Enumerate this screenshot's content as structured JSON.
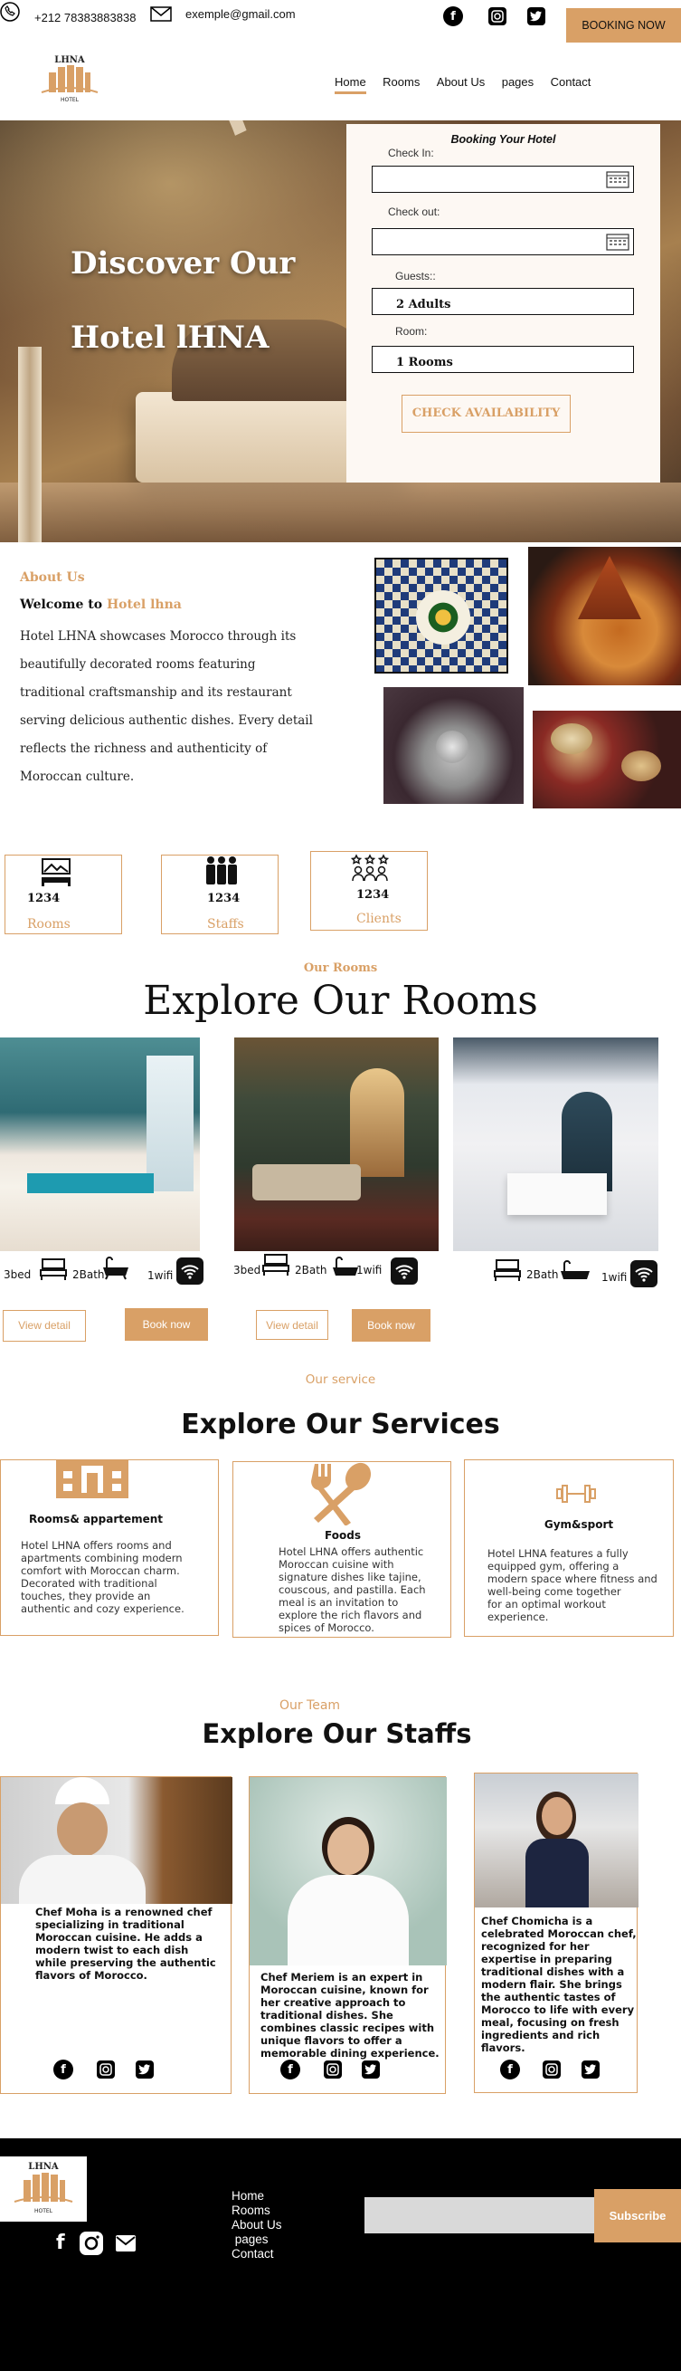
{
  "topbar": {
    "phone": "+212 78383883838",
    "email": "exemple@gmail.com",
    "booking_button": "BOOKING NOW"
  },
  "logo": {
    "text": "LHNA",
    "sub": "HOTEL"
  },
  "nav": {
    "items": [
      "Home",
      "Rooms",
      "About Us",
      "pages",
      "Contact"
    ]
  },
  "hero": {
    "line1": "Discover Our",
    "line2": "Hotel lHNA"
  },
  "booking": {
    "title": "Booking Your Hotel",
    "checkin_label": "Check In:",
    "checkout_label": "Check out:",
    "guests_label": "Guests::",
    "guests_value": "2 Adults",
    "room_label": "Room:",
    "room_value": "1 Rooms",
    "cta": "CHECK AVAILABILITY"
  },
  "about": {
    "eyebrow": "About Us",
    "welcome_prefix": "Welcome to ",
    "welcome_name": "Hotel lhna",
    "body_lines": [
      "Hotel LHNA showcases Morocco through its",
      "beautifully decorated rooms featuring",
      "traditional craftsmanship and its restaurant",
      "serving delicious authentic dishes. Every detail",
      "reflects the richness and authenticity of",
      "Moroccan culture."
    ]
  },
  "stats": [
    {
      "value": "1234",
      "label": "Rooms"
    },
    {
      "value": "1234",
      "label": "Staffs"
    },
    {
      "value": "1234",
      "label": "Clients"
    }
  ],
  "rooms": {
    "eyebrow": "Our Rooms",
    "title": "Explore Our Rooms",
    "cards": [
      {
        "bed": "3bed",
        "bath": "2Bath",
        "wifi": "1wifi"
      },
      {
        "bed": "3bed",
        "bath": "2Bath",
        "wifi": "1wifi"
      },
      {
        "bed": "",
        "bath": "2Bath",
        "wifi": "1wifi"
      }
    ],
    "view_detail": "View detail",
    "book_now": "Book now"
  },
  "services": {
    "eyebrow": "Our service",
    "title": "Explore Our Services",
    "items": [
      {
        "title": "Rooms& appartement",
        "text": "Hotel LHNA offers rooms and apartments combining modern comfort with Moroccan charm. Decorated with traditional touches, they provide an authentic and cozy experience."
      },
      {
        "title": "Foods",
        "text": "Hotel LHNA offers authentic Moroccan cuisine with signature dishes like tajine, couscous, and pastilla. Each meal is an invitation to explore the rich flavors and spices of Morocco."
      },
      {
        "title": "Gym&sport",
        "text": "Hotel LHNA features a fully equipped gym, offering a modern space where fitness and well-being come together\n for an optimal workout experience."
      }
    ]
  },
  "team": {
    "eyebrow": "Our Team",
    "title": "Explore Our Staffs",
    "members": [
      {
        "text": "Chef Moha is a renowned chef specializing in traditional Moroccan cuisine. He adds a modern twist to each dish while preserving the authentic flavors of Morocco."
      },
      {
        "text": "Chef Meriem is an expert in Moroccan cuisine, known for her creative approach to traditional dishes. She combines classic recipes with unique flavors to offer a memorable dining experience."
      },
      {
        "text": "Chef Chomicha is a celebrated Moroccan chef, recognized for her expertise in preparing traditional dishes with a modern flair. She brings the authentic tastes of Morocco to life with every meal, focusing on fresh ingredients and rich flavors."
      }
    ]
  },
  "footer": {
    "links": [
      "Home",
      "Rooms",
      "About Us",
      " pages",
      "Contact"
    ],
    "subscribe": "Subscribe",
    "subscribe_placeholder": ""
  },
  "colors": {
    "accent": "#d9a066",
    "footer_bg": "#000000"
  }
}
